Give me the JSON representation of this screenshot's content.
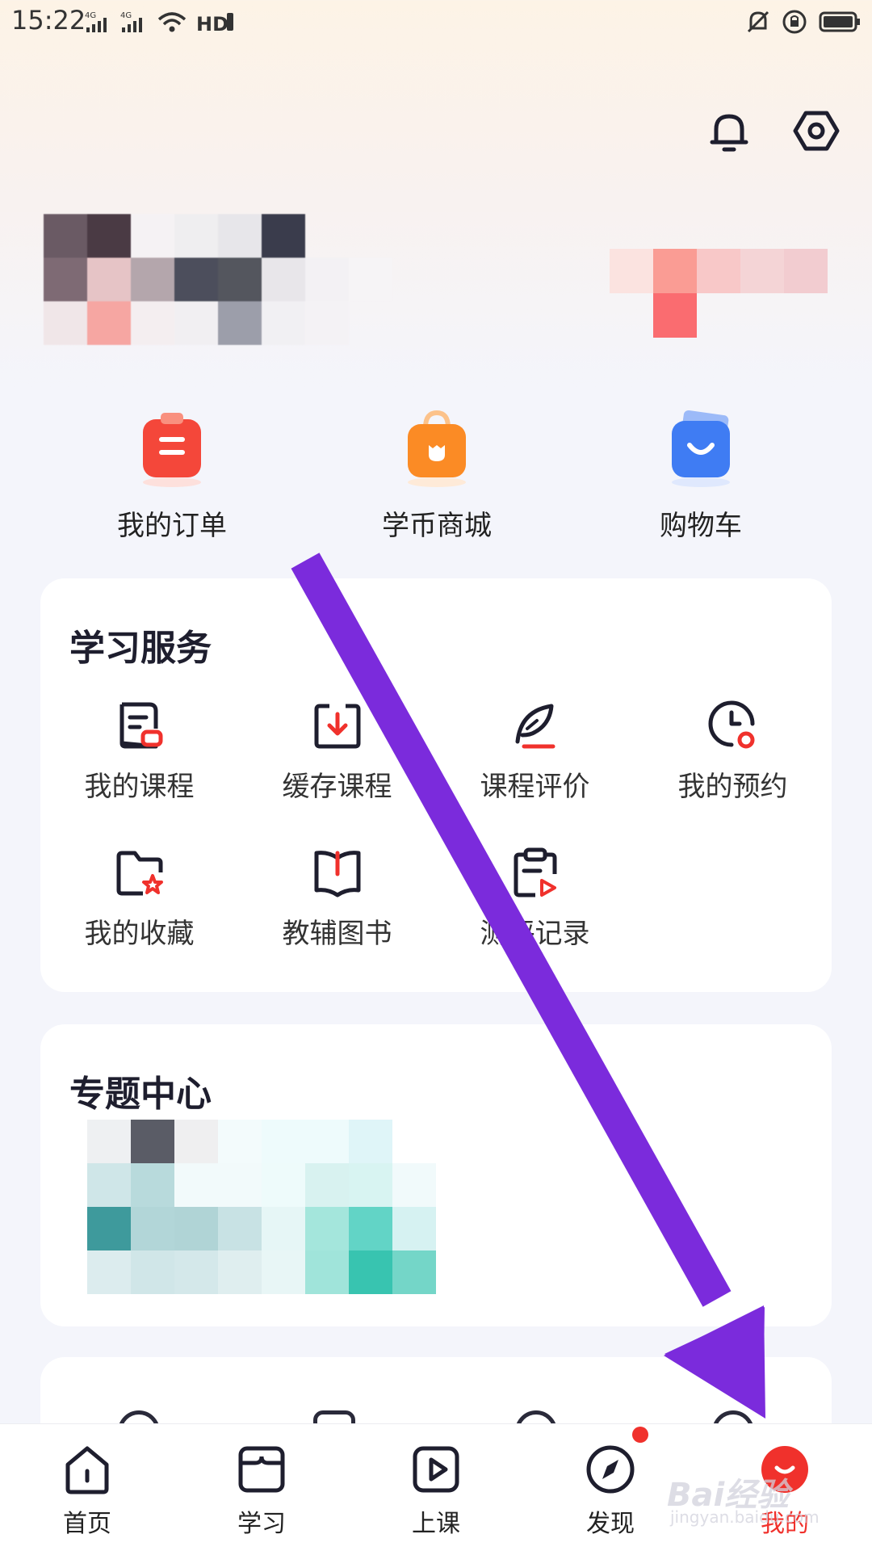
{
  "status_bar": {
    "time": "15:22",
    "network_1": "4G",
    "network_2": "4G",
    "hd_label": "HD"
  },
  "header": {
    "bell_icon": "bell-icon",
    "settings_icon": "settings-hexagon-icon"
  },
  "quick_entries": [
    {
      "label": "我的订单",
      "icon": "order-clipboard-icon",
      "color": "#f4473a"
    },
    {
      "label": "学币商城",
      "icon": "shopping-bag-icon",
      "color": "#fb8b25"
    },
    {
      "label": "购物车",
      "icon": "cart-bag-icon",
      "color": "#3f7cf3"
    }
  ],
  "learning_services": {
    "title": "学习服务",
    "items": [
      {
        "label": "我的课程",
        "icon": "course-doc-icon"
      },
      {
        "label": "缓存课程",
        "icon": "download-cache-icon"
      },
      {
        "label": "课程评价",
        "icon": "feather-pen-icon"
      },
      {
        "label": "我的预约",
        "icon": "clock-icon"
      },
      {
        "label": "我的收藏",
        "icon": "folder-star-icon"
      },
      {
        "label": "教辅图书",
        "icon": "book-icon"
      },
      {
        "label": "测评记录",
        "icon": "clipboard-play-icon"
      }
    ]
  },
  "topic_center": {
    "title": "专题中心"
  },
  "tab_bar": {
    "tabs": [
      {
        "label": "首页",
        "icon": "home-icon"
      },
      {
        "label": "学习",
        "icon": "study-book-icon"
      },
      {
        "label": "上课",
        "icon": "play-class-icon"
      },
      {
        "label": "发现",
        "icon": "compass-icon"
      },
      {
        "label": "我的",
        "icon": "me-smile-icon"
      }
    ],
    "active_index": 4,
    "accent_color": "#f0312c"
  },
  "watermark": {
    "text": "Bai经验",
    "sub": "jingyan.baidu.com"
  },
  "colors": {
    "accent": "#f0312c",
    "annotation_arrow": "#7b2bdc"
  }
}
